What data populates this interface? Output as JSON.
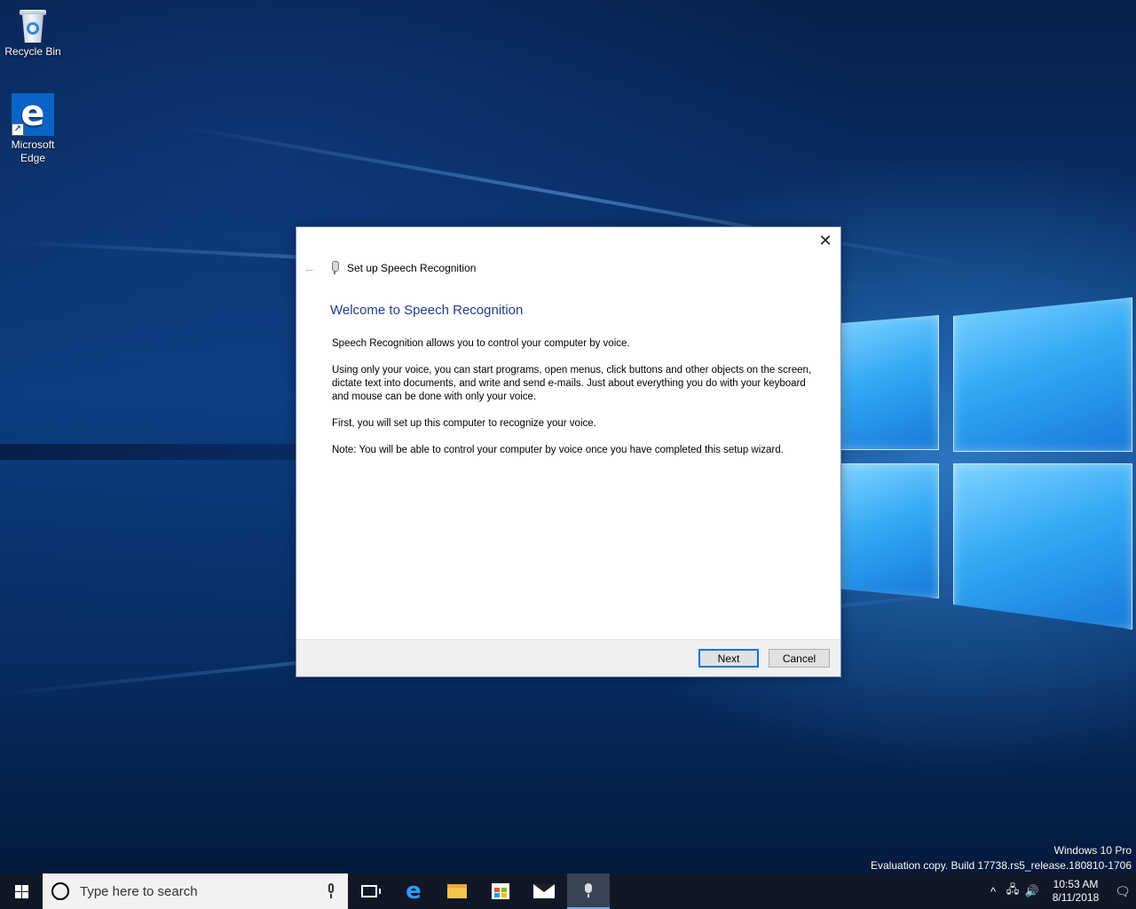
{
  "desktop": {
    "icons": [
      {
        "label": "Recycle Bin",
        "icon": "recycle-bin-icon"
      },
      {
        "label": "Microsoft Edge",
        "icon": "edge-icon"
      }
    ],
    "watermark": {
      "edition": "Windows 10 Pro",
      "build": "Evaluation copy. Build 17738.rs5_release.180810-1706"
    }
  },
  "dialog": {
    "nav_title": "Set up Speech Recognition",
    "heading": "Welcome to Speech Recognition",
    "paragraphs": [
      "Speech Recognition allows you to control your computer by voice.",
      "Using only your voice, you can start programs, open menus, click buttons and other objects on the screen, dictate text into documents, and write and send e-mails. Just about everything you do with your keyboard and mouse can be done with only your voice.",
      "First, you will set up this computer to recognize your voice.",
      "Note: You will be able to control your computer by voice once you have completed this setup wizard."
    ],
    "close_glyph": "✕",
    "back_glyph": "←",
    "next_label": "Next",
    "cancel_label": "Cancel"
  },
  "taskbar": {
    "search_placeholder": "Type here to search",
    "clock_time": "10:53 AM",
    "clock_date": "8/11/2018",
    "tray_chevron": "^",
    "tray_network": "🖧",
    "tray_volume": "🔊",
    "notification_glyph": "🗨"
  },
  "colors": {
    "dialog_heading": "#1e3f8a",
    "accent": "#0078d7",
    "taskbar": "#101828"
  }
}
